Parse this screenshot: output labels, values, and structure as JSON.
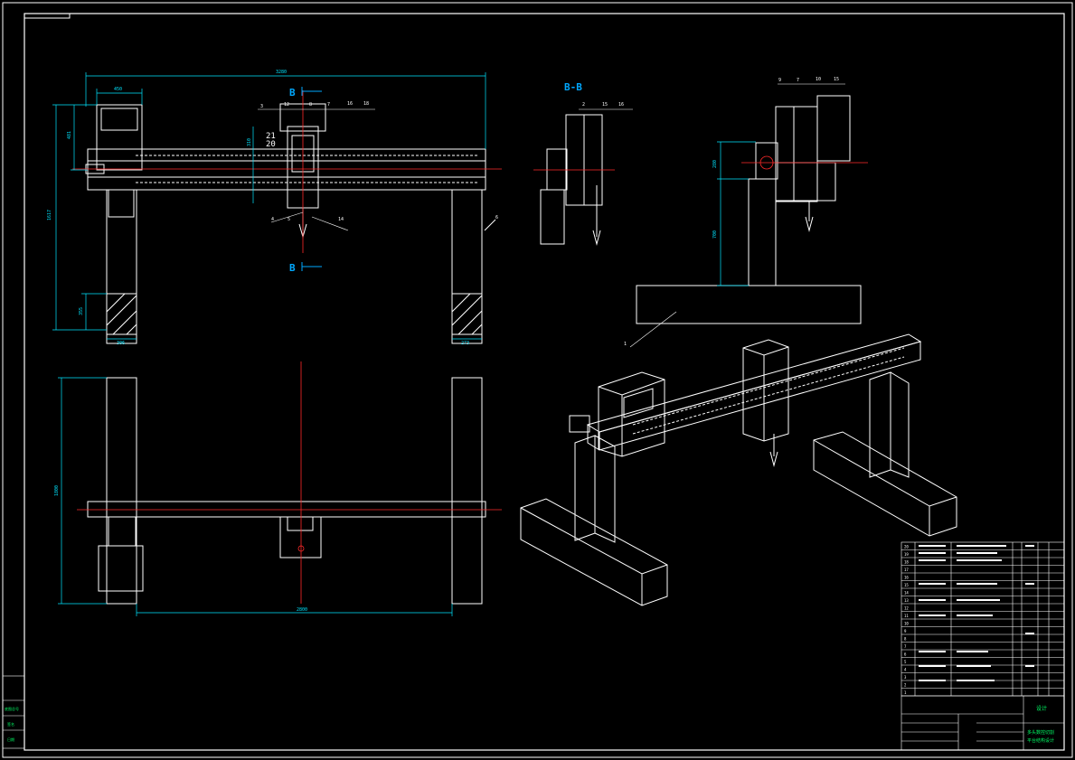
{
  "drawing": {
    "colors": {
      "background": "#000000",
      "lines": "#ffffff",
      "dimensions": "#00e5ff",
      "centerlines": "#ff2a2a",
      "section": "#00a8ff",
      "title_green": "#00ff66",
      "title_yellow": "#ffff00"
    },
    "section_marks": {
      "top": "B",
      "bottom": "B",
      "view_title": "B-B"
    },
    "dimensions": {
      "overall_width": "3280",
      "top_left_box": "450",
      "left_height_total": "1617",
      "left_upper": "481",
      "left_foot": "355",
      "foot_width_left": "306",
      "foot_width_right": "273",
      "carriage_height": "310",
      "plan_height": "1800",
      "plan_span": "2800",
      "side_upper": "280",
      "side_lower": "700"
    },
    "part_labels": {
      "front_top": [
        "3",
        "12",
        "8",
        "7",
        "16",
        "18"
      ],
      "front_mid": [
        "21",
        "20"
      ],
      "front_bottom": [
        "4",
        "5",
        "14"
      ],
      "front_side": "6",
      "section_top": [
        "2",
        "15",
        "16"
      ],
      "side_top": [
        "9",
        "7",
        "10",
        "15"
      ],
      "side_base": "1"
    },
    "bom": {
      "rows": [
        "20",
        "19",
        "18",
        "17",
        "16",
        "15",
        "14",
        "13",
        "12",
        "11",
        "10",
        "9",
        "8",
        "7",
        "6",
        "5",
        "4",
        "3",
        "2",
        "1"
      ]
    },
    "title_block": {
      "label": "设计",
      "name_line1": "多头数控切割",
      "name_line2": "平台结构设计"
    },
    "left_stamp": [
      "底图总号",
      "签名",
      "日期"
    ]
  }
}
